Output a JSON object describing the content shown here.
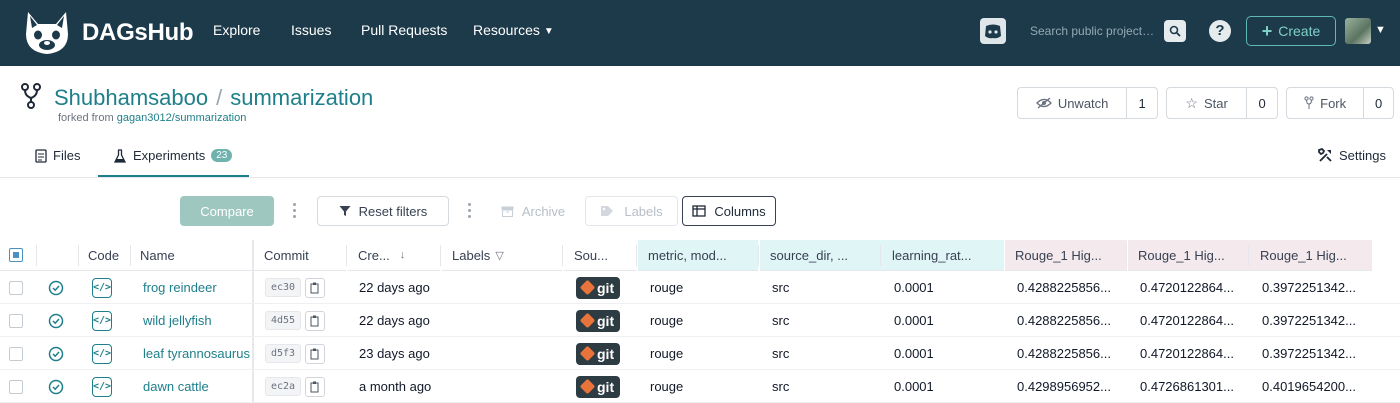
{
  "nav": {
    "brand": "DAGsHub",
    "links": [
      "Explore",
      "Issues",
      "Pull Requests",
      "Resources"
    ],
    "search_placeholder": "Search public projects...",
    "help": "?",
    "create_label": "Create",
    "icons": {
      "discord": "discord-icon",
      "search": "search-icon",
      "avatar": "user-avatar"
    },
    "bg_color": "#1d3a4a",
    "accent_color": "#5fb8b3"
  },
  "repo": {
    "owner": "Shubhamsaboo",
    "separator": "/",
    "name": "summarization",
    "forked_prefix": "forked from",
    "forked_from": "gagan3012/summarization",
    "watch_label": "Unwatch",
    "watch_count": "1",
    "star_label": "Star",
    "star_count": "0",
    "fork_label": "Fork",
    "fork_count": "0"
  },
  "tabs": {
    "files": "Files",
    "experiments": "Experiments",
    "experiments_count": "23",
    "settings": "Settings"
  },
  "toolbar": {
    "compare": "Compare",
    "reset_filters": "Reset filters",
    "archive": "Archive",
    "labels": "Labels",
    "columns": "Columns"
  },
  "table": {
    "headers": [
      "Code",
      "Name",
      "Commit",
      "Cre...",
      "Labels",
      "Sou...",
      "metric, mod...",
      "source_dir, ...",
      "learning_rat...",
      "Rouge_1 Hig...",
      "Rouge_1 Hig...",
      "Rouge_1 Hig..."
    ],
    "sort_indicator": "↓",
    "filter_indicator": "▽",
    "source_badge": "git",
    "rows": [
      {
        "name": "frog reindeer",
        "commit": "ec30",
        "created": "22 days ago",
        "metric": "rouge",
        "source_dir": "src",
        "lr": "0.0001",
        "r1": "0.4288225856...",
        "r2": "0.4720122864...",
        "r3": "0.3972251342..."
      },
      {
        "name": "wild jellyfish",
        "commit": "4d55",
        "created": "22 days ago",
        "metric": "rouge",
        "source_dir": "src",
        "lr": "0.0001",
        "r1": "0.4288225856...",
        "r2": "0.4720122864...",
        "r3": "0.3972251342..."
      },
      {
        "name": "leaf tyrannosaurus",
        "commit": "d5f3",
        "created": "23 days ago",
        "metric": "rouge",
        "source_dir": "src",
        "lr": "0.0001",
        "r1": "0.4288225856...",
        "r2": "0.4720122864...",
        "r3": "0.3972251342..."
      },
      {
        "name": "dawn cattle",
        "commit": "ec2a",
        "created": "a month ago",
        "metric": "rouge",
        "source_dir": "src",
        "lr": "0.0001",
        "r1": "0.4298956952...",
        "r2": "0.4726861301...",
        "r3": "0.4019654200..."
      }
    ]
  }
}
